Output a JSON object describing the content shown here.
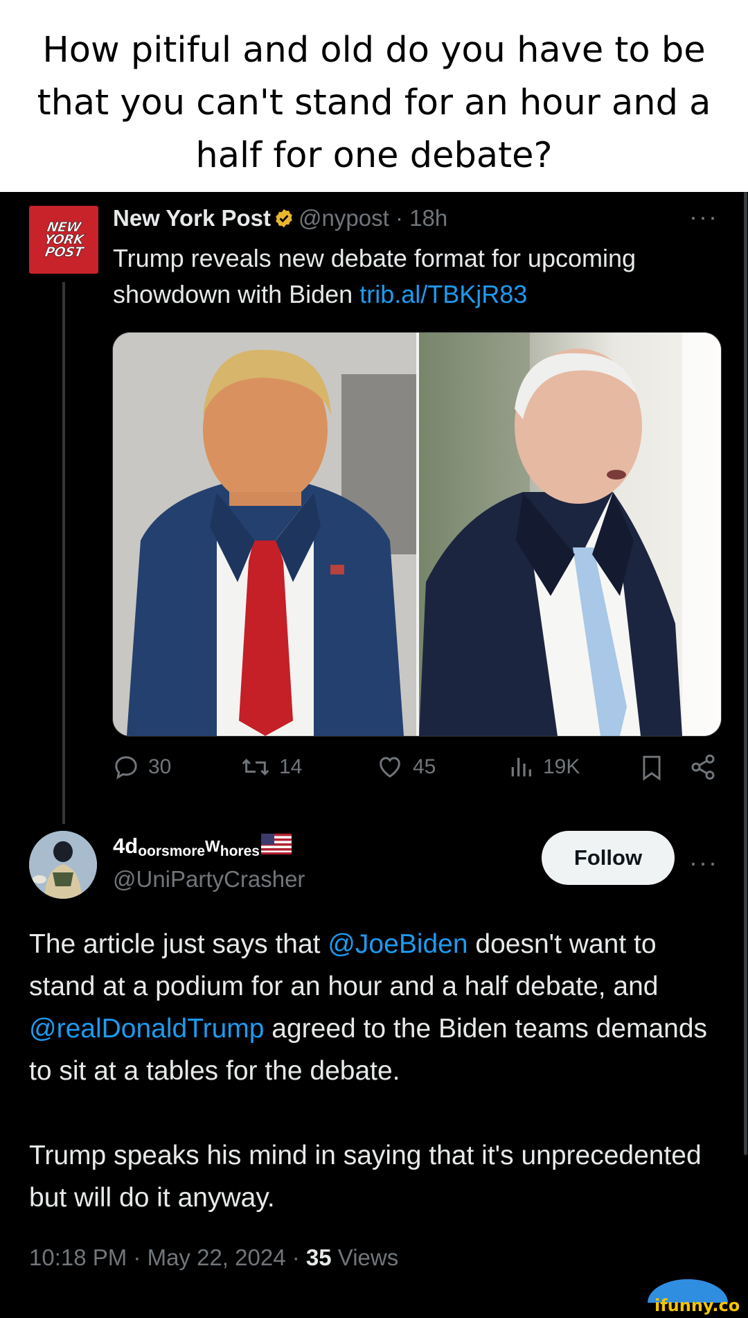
{
  "caption": {
    "line1": "How pitiful and old do you have to be",
    "line2": "that you can't stand for an hour and a",
    "line3": "half for one debate?"
  },
  "tweet": {
    "logo_lines": [
      "NEW",
      "YORK",
      "POST"
    ],
    "author": "New York Post",
    "handle": "@nypost",
    "separator": "·",
    "time": "18h",
    "text": "Trump reveals new debate format for upcoming showdown with Biden",
    "link": "trib.al/TBKjR83",
    "more": "···",
    "stats": {
      "replies": "30",
      "reposts": "14",
      "likes": "45",
      "views": "19K"
    }
  },
  "reply": {
    "display_name_base": "4d",
    "display_name_sub1": "oorsmore",
    "display_name_mid": "W",
    "display_name_sub2": "hores",
    "handle": "@UniPartyCrasher",
    "follow_label": "Follow",
    "more": "···",
    "p1_a": "The article just says that ",
    "p1_mention1": "@JoeBiden",
    "p1_b": " doesn't want to stand at a podium for an hour and a half debate, and ",
    "p1_mention2": "@realDonaldTrump",
    "p1_c": " agreed to the Biden teams demands to sit at a tables for the debate.",
    "p2": "Trump speaks his mind in saying that it's unprecedented but will do it anyway.",
    "time": "10:18 PM",
    "separator": "·",
    "date": "May 22, 2024",
    "separator2": "·",
    "views_count": "35",
    "views_label": "Views"
  },
  "watermark": "ifunny.co",
  "colors": {
    "link_blue": "#1d9bf0",
    "verified_gold": "#e8b730",
    "nypost_red": "#c8222b",
    "muted": "#71767b"
  }
}
